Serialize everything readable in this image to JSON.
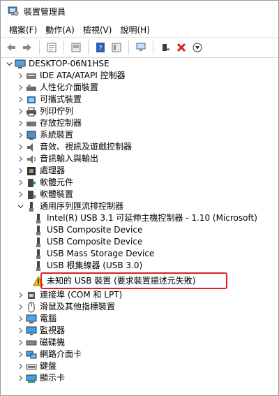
{
  "window": {
    "title": "裝置管理員"
  },
  "menu": [
    {
      "label": "檔案(F)"
    },
    {
      "label": "動作(A)"
    },
    {
      "label": "檢視(V)"
    },
    {
      "label": "說明(H)"
    }
  ],
  "toolbar": {
    "buttons": [
      "back-arrow-icon",
      "forward-arrow-icon",
      "properties-icon",
      "update-icon",
      "help-icon",
      "show-hidden-icon",
      "monitor-icon",
      "enable-device-icon",
      "uninstall-x-icon",
      "download-icon"
    ]
  },
  "tree": {
    "root": "DESKTOP-06N1HSE",
    "categories": [
      {
        "label": "IDE ATA/ATAPI 控制器"
      },
      {
        "label": "人性化介面裝置"
      },
      {
        "label": "可攜式裝置"
      },
      {
        "label": "列印佇列"
      },
      {
        "label": "存放控制器"
      },
      {
        "label": "系統裝置"
      },
      {
        "label": "音效、視訊及遊戲控制器"
      },
      {
        "label": "音訊輸入與輸出"
      },
      {
        "label": "處理器"
      },
      {
        "label": "軟體元件"
      },
      {
        "label": "軟體裝置"
      },
      {
        "label": "通用序列匯流排控制器"
      }
    ],
    "usb_children": [
      {
        "label": "Intel(R) USB 3.1 可延伸主機控制器 - 1.10 (Microsoft)"
      },
      {
        "label": "USB Composite Device"
      },
      {
        "label": "USB Composite Device"
      },
      {
        "label": "USB Mass Storage Device"
      },
      {
        "label": "USB 根集線器 (USB 3.0)"
      },
      {
        "label": "未知的 USB 裝置 (要求裝置描述元失敗)",
        "status": "warning"
      }
    ],
    "more_categories": [
      {
        "label": "連接埠 (COM 和 LPT)"
      },
      {
        "label": "滑鼠及其他指標裝置"
      },
      {
        "label": "電腦"
      },
      {
        "label": "監視器"
      },
      {
        "label": "磁碟機"
      },
      {
        "label": "網路介面卡"
      },
      {
        "label": "鍵盤"
      },
      {
        "label": "顯示卡"
      }
    ]
  },
  "colors": {
    "highlight_border": "#e02020",
    "warning": "#f2c200"
  }
}
